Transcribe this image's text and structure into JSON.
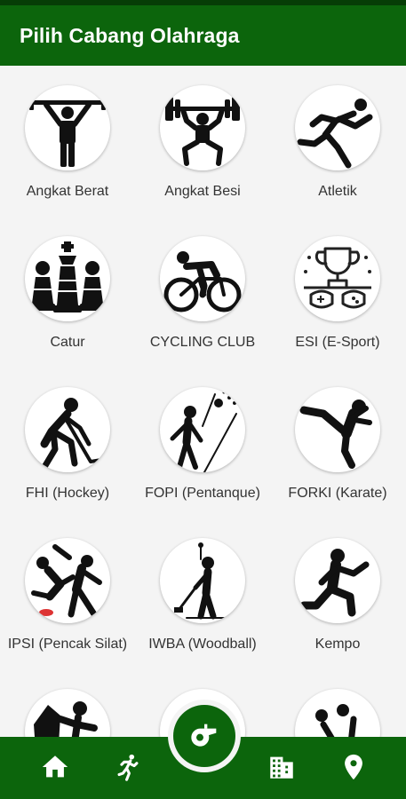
{
  "app": {
    "title": "Pilih Cabang Olahraga"
  },
  "sports": [
    {
      "label": "Angkat Berat",
      "icon": "powerlifting-icon"
    },
    {
      "label": "Angkat Besi",
      "icon": "weightlifting-icon"
    },
    {
      "label": "Atletik",
      "icon": "athletics-runner-icon"
    },
    {
      "label": "Catur",
      "icon": "chess-pieces-icon"
    },
    {
      "label": "CYCLING CLUB",
      "icon": "cycling-icon"
    },
    {
      "label": "ESI (E-Sport)",
      "icon": "esport-trophy-icon"
    },
    {
      "label": "FHI (Hockey)",
      "icon": "hockey-icon"
    },
    {
      "label": "FOPI (Pentanque)",
      "icon": "petanque-icon"
    },
    {
      "label": "FORKI (Karate)",
      "icon": "karate-kick-icon"
    },
    {
      "label": "IPSI (Pencak Silat)",
      "icon": "pencak-silat-icon"
    },
    {
      "label": "IWBA (Woodball)",
      "icon": "woodball-icon"
    },
    {
      "label": "Kempo",
      "icon": "kempo-icon"
    },
    {
      "label": "",
      "icon": "climbing-icon"
    },
    {
      "label": "",
      "icon": "sport-icon"
    },
    {
      "label": "",
      "icon": "volleyball-icon"
    }
  ],
  "bottom_nav": [
    {
      "name": "home",
      "icon": "home-icon"
    },
    {
      "name": "sports",
      "icon": "athlete-icon"
    },
    {
      "name": "whistle",
      "icon": "whistle-icon"
    },
    {
      "name": "venues",
      "icon": "building-icon"
    },
    {
      "name": "location",
      "icon": "location-pin-icon"
    }
  ],
  "colors": {
    "primary": "#0c650c",
    "status_bar": "#063d06",
    "background": "#f4f4f4",
    "icon": "#111111",
    "label": "#333333"
  }
}
